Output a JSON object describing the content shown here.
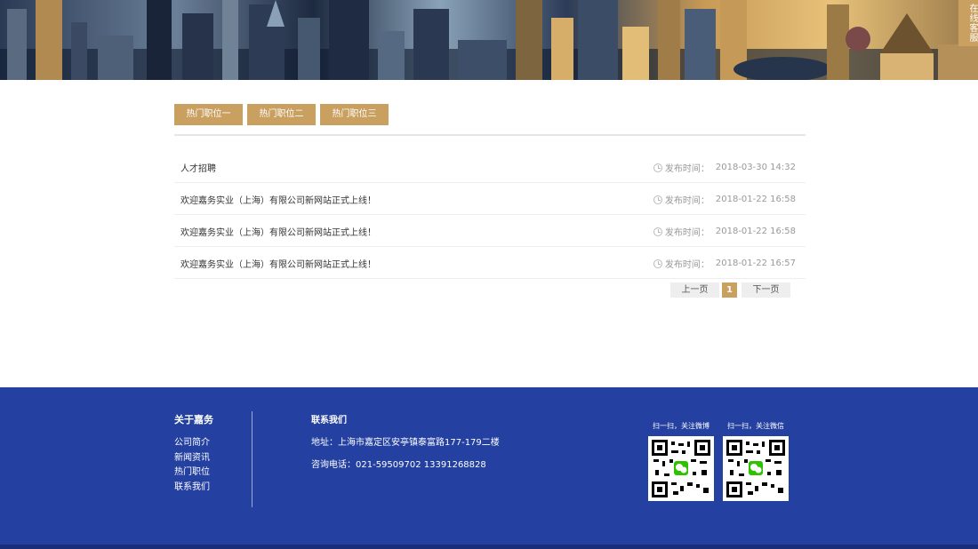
{
  "banner": {
    "customer_service": "在线客服"
  },
  "tabs": [
    "热门职位一",
    "热门职位二",
    "热门职位三"
  ],
  "news": [
    {
      "title": "人才招聘",
      "meta_label": "发布时间：",
      "date": "2018-03-30 14:32"
    },
    {
      "title": "欢迎嘉务实业（上海）有限公司新网站正式上线！",
      "meta_label": "发布时间：",
      "date": "2018-01-22 16:58"
    },
    {
      "title": "欢迎嘉务实业（上海）有限公司新网站正式上线！",
      "meta_label": "发布时间：",
      "date": "2018-01-22 16:58"
    },
    {
      "title": "欢迎嘉务实业（上海）有限公司新网站正式上线！",
      "meta_label": "发布时间：",
      "date": "2018-01-22 16:57"
    }
  ],
  "pager": {
    "prev": "上一页",
    "current": "1",
    "next": "下一页"
  },
  "footer": {
    "about_title": "关于嘉务",
    "about_links": [
      "公司简介",
      "新闻资讯",
      "热门职位",
      "联系我们"
    ],
    "contact_title": "联系我们",
    "address": "地址：上海市嘉定区安亭镇泰富路177-179二楼",
    "phone": "咨询电话：021-59509702  13391268828",
    "qr_weibo_caption": "扫一扫，关注微博",
    "qr_wechat_caption": "扫一扫，关注微信"
  },
  "colors": {
    "accent": "#c9a060",
    "footer_bg": "#2440a0"
  }
}
